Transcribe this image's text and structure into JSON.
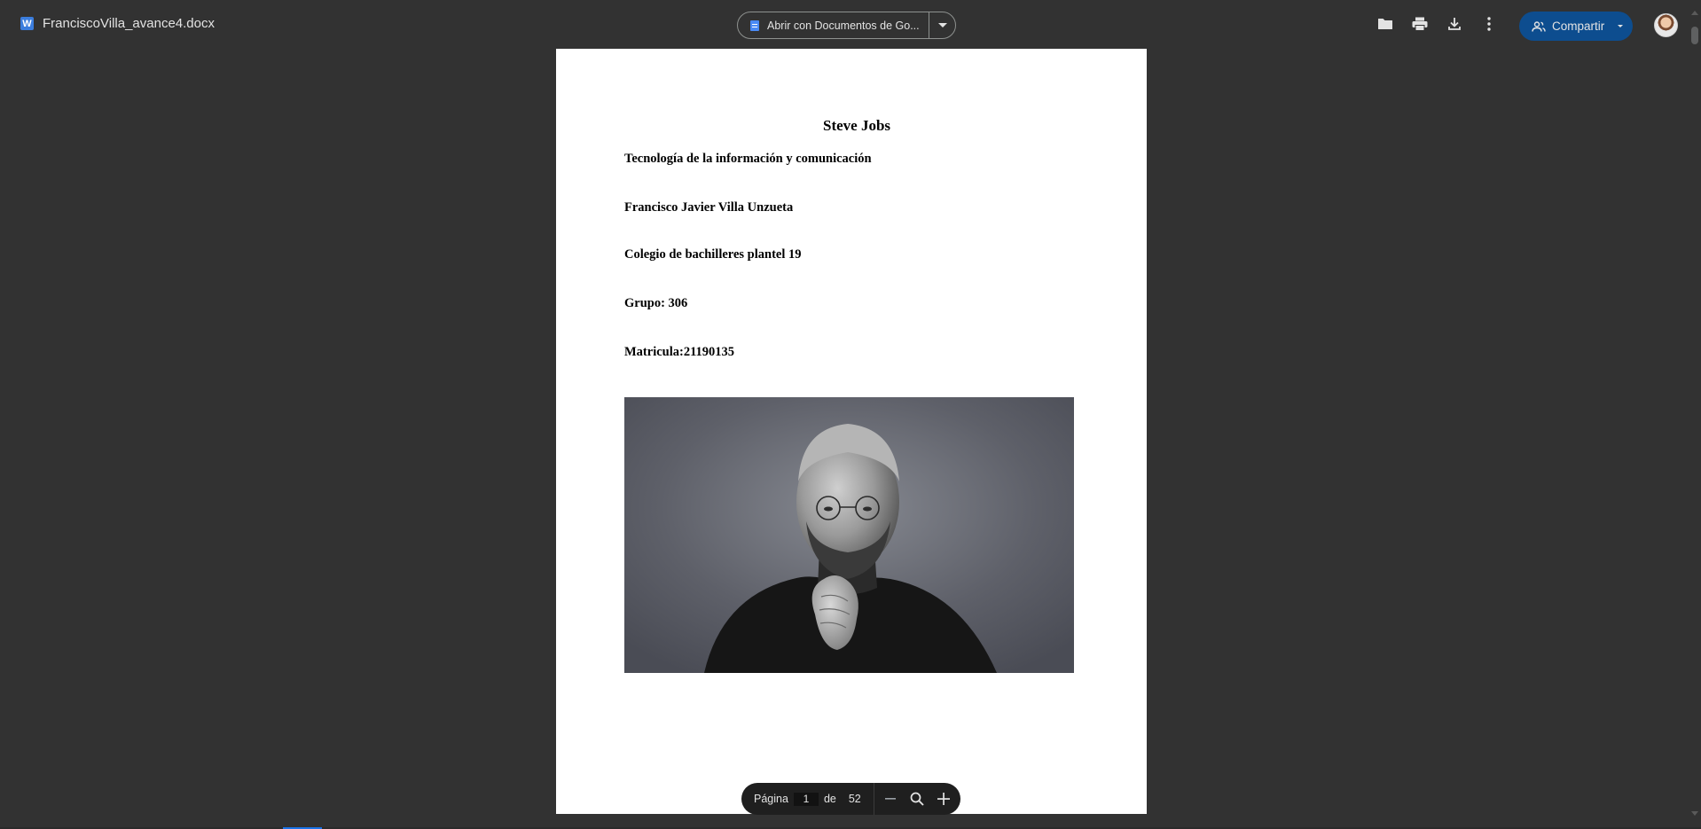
{
  "topbar": {
    "file_name": "FranciscoVilla_avance4.docx",
    "file_type_icon_letter": "W",
    "open_with_label": "Abrir con Documentos de Go...",
    "share_label": "Compartir"
  },
  "document": {
    "title": "Steve Jobs",
    "lines": [
      "Tecnología de la información y comunicación",
      "Francisco Javier Villa Unzueta",
      "Colegio de bachilleres plantel 19",
      "Grupo: 306",
      "Matricula:21190135"
    ]
  },
  "page_bar": {
    "page_label": "Página",
    "current_page": "1",
    "of_label": "de",
    "total_pages": "52"
  },
  "colors": {
    "background": "#323232",
    "page": "#ffffff",
    "share_button": "#0d4d8f",
    "word_icon": "#3b7ddd",
    "docs_icon": "#4a8af4"
  },
  "icons": [
    "word-icon",
    "docs-icon",
    "caret-down-icon",
    "folder-icon",
    "print-icon",
    "download-icon",
    "more-vert-icon",
    "people-icon",
    "avatar",
    "zoom-out-icon",
    "zoom-icon",
    "zoom-in-icon"
  ]
}
